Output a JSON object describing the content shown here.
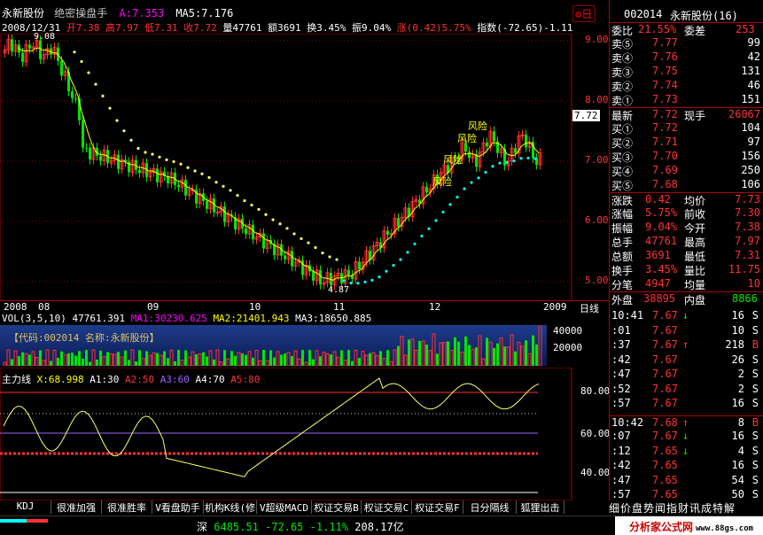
{
  "header": {
    "stock_name": "永新股份",
    "indicator_name": "绝密操盘手",
    "line_a_label": "A:7.353",
    "ma5_label": "MA5:7.176",
    "date": "2008/12/31",
    "open": "开7.38",
    "high": "高7.97",
    "low": "低7.31",
    "close": "收7.72",
    "volume": "量47761",
    "amount": "额3691",
    "turnover": "换3.45%",
    "amplitude": "振9.04%",
    "change": "涨(0.42)5.75%",
    "index_change": "指数(-72.65)-1.11"
  },
  "price_axis": {
    "labels": [
      "9.00",
      "8.00",
      "7.00",
      "6.00",
      "5.00"
    ],
    "current": "7.72"
  },
  "annotations": {
    "high": "9.08",
    "low": "4.87",
    "risk": "风险",
    "tab_label": "日"
  },
  "time_axis": {
    "labels": [
      "2008",
      "08",
      "09",
      "10",
      "11",
      "12",
      "2009"
    ],
    "period": "日线"
  },
  "volume_panel": {
    "title": "VOL(3,5,10)",
    "vol": "47761.391",
    "ma1": "MA1:30230.625",
    "ma2": "MA2:21401.943",
    "ma3": "MA3:18650.885",
    "banner": "【代码:002014 名称:永新股份】",
    "axis": [
      "40000",
      "20000"
    ]
  },
  "indicator_panel": {
    "title": "主力线",
    "x": "X:68.998",
    "a1": "A1:30",
    "a2": "A2:50",
    "a3": "A3:60",
    "a4": "A4:70",
    "a5": "A5:80",
    "axis": [
      "80.00",
      "60.00",
      "40.00"
    ]
  },
  "quote": {
    "code": "002014",
    "name": "永新股份(16)",
    "wb_label": "委比",
    "wb": "21.55%",
    "wc_label": "委差",
    "wc": "253",
    "asks": [
      {
        "label": "卖⑤",
        "price": "7.77",
        "vol": "99"
      },
      {
        "label": "卖④",
        "price": "7.76",
        "vol": "42"
      },
      {
        "label": "卖③",
        "price": "7.75",
        "vol": "131"
      },
      {
        "label": "卖②",
        "price": "7.74",
        "vol": "46"
      },
      {
        "label": "卖①",
        "price": "7.73",
        "vol": "151"
      }
    ],
    "last_label": "最新",
    "last": "7.72",
    "now_label": "现手",
    "now": "26067",
    "bids": [
      {
        "label": "买①",
        "price": "7.72",
        "vol": "104"
      },
      {
        "label": "买②",
        "price": "7.71",
        "vol": "97"
      },
      {
        "label": "买③",
        "price": "7.70",
        "vol": "156"
      },
      {
        "label": "买④",
        "price": "7.69",
        "vol": "250"
      },
      {
        "label": "买⑤",
        "price": "7.68",
        "vol": "106"
      }
    ],
    "stats": [
      {
        "l1": "涨跌",
        "v1": "0.42",
        "l2": "均价",
        "v2": "7.73"
      },
      {
        "l1": "涨幅",
        "v1": "5.75%",
        "l2": "前收",
        "v2": "7.30"
      },
      {
        "l1": "振幅",
        "v1": "9.04%",
        "l2": "今开",
        "v2": "7.38"
      },
      {
        "l1": "总手",
        "v1": "47761",
        "l2": "最高",
        "v2": "7.97"
      },
      {
        "l1": "总额",
        "v1": "3691",
        "l2": "最低",
        "v2": "7.31"
      },
      {
        "l1": "换手",
        "v1": "3.45%",
        "l2": "量比",
        "v2": "11.75"
      },
      {
        "l1": "分笔",
        "v1": "4947",
        "l2": "均量",
        "v2": "10"
      }
    ],
    "outer_label": "外盘",
    "outer": "38895",
    "inner_label": "内盘",
    "inner": "8866"
  },
  "ticks": [
    {
      "time": "10:41",
      "price": "7.67",
      "arrow": "↓",
      "vol": "16",
      "side": "S"
    },
    {
      "time": ":01",
      "price": "7.67",
      "arrow": "",
      "vol": "10",
      "side": "S"
    },
    {
      "time": ":37",
      "price": "7.67",
      "arrow": "↑",
      "vol": "218",
      "side": "B"
    },
    {
      "time": ":42",
      "price": "7.67",
      "arrow": "",
      "vol": "26",
      "side": "S"
    },
    {
      "time": ":47",
      "price": "7.67",
      "arrow": "",
      "vol": "2",
      "side": "S"
    },
    {
      "time": ":52",
      "price": "7.67",
      "arrow": "",
      "vol": "2",
      "side": "S"
    },
    {
      "time": ":57",
      "price": "7.67",
      "arrow": "",
      "vol": "16",
      "side": "S"
    },
    {
      "time": "10:42",
      "price": "7.68",
      "arrow": "↑",
      "vol": "8",
      "side": "B"
    },
    {
      "time": ":07",
      "price": "7.67",
      "arrow": "↓",
      "vol": "16",
      "side": "S"
    },
    {
      "time": ":12",
      "price": "7.65",
      "arrow": "↓",
      "vol": "4",
      "side": "S"
    },
    {
      "time": ":42",
      "price": "7.65",
      "arrow": "",
      "vol": "16",
      "side": "S"
    },
    {
      "time": ":47",
      "price": "7.65",
      "arrow": "",
      "vol": "54",
      "side": "S"
    },
    {
      "time": ":57",
      "price": "7.65",
      "arrow": "",
      "vol": "50",
      "side": "S"
    }
  ],
  "tabs": [
    "KDJ",
    "很准加强",
    "很准胜率",
    "V看盘助手",
    "机构K线(修",
    "V超级MACD",
    "权证交易B",
    "权证交易C",
    "权证交易F",
    "日分隔线",
    "狐狸出击"
  ],
  "right_tabs": "细价盘势闻指财讯成特解",
  "status": {
    "market": "深",
    "index": "6485.51",
    "change": "-72.65",
    "pct": "-1.11%",
    "amount": "208.17亿",
    "watermark": "分析家公式网",
    "watermark_url": "www.88gs.com"
  },
  "colors": {
    "up": "#ff3232",
    "down": "#00e600",
    "ma": "#ffff00",
    "support": "#00ffff",
    "bg": "#000000",
    "grid": "#800000"
  }
}
